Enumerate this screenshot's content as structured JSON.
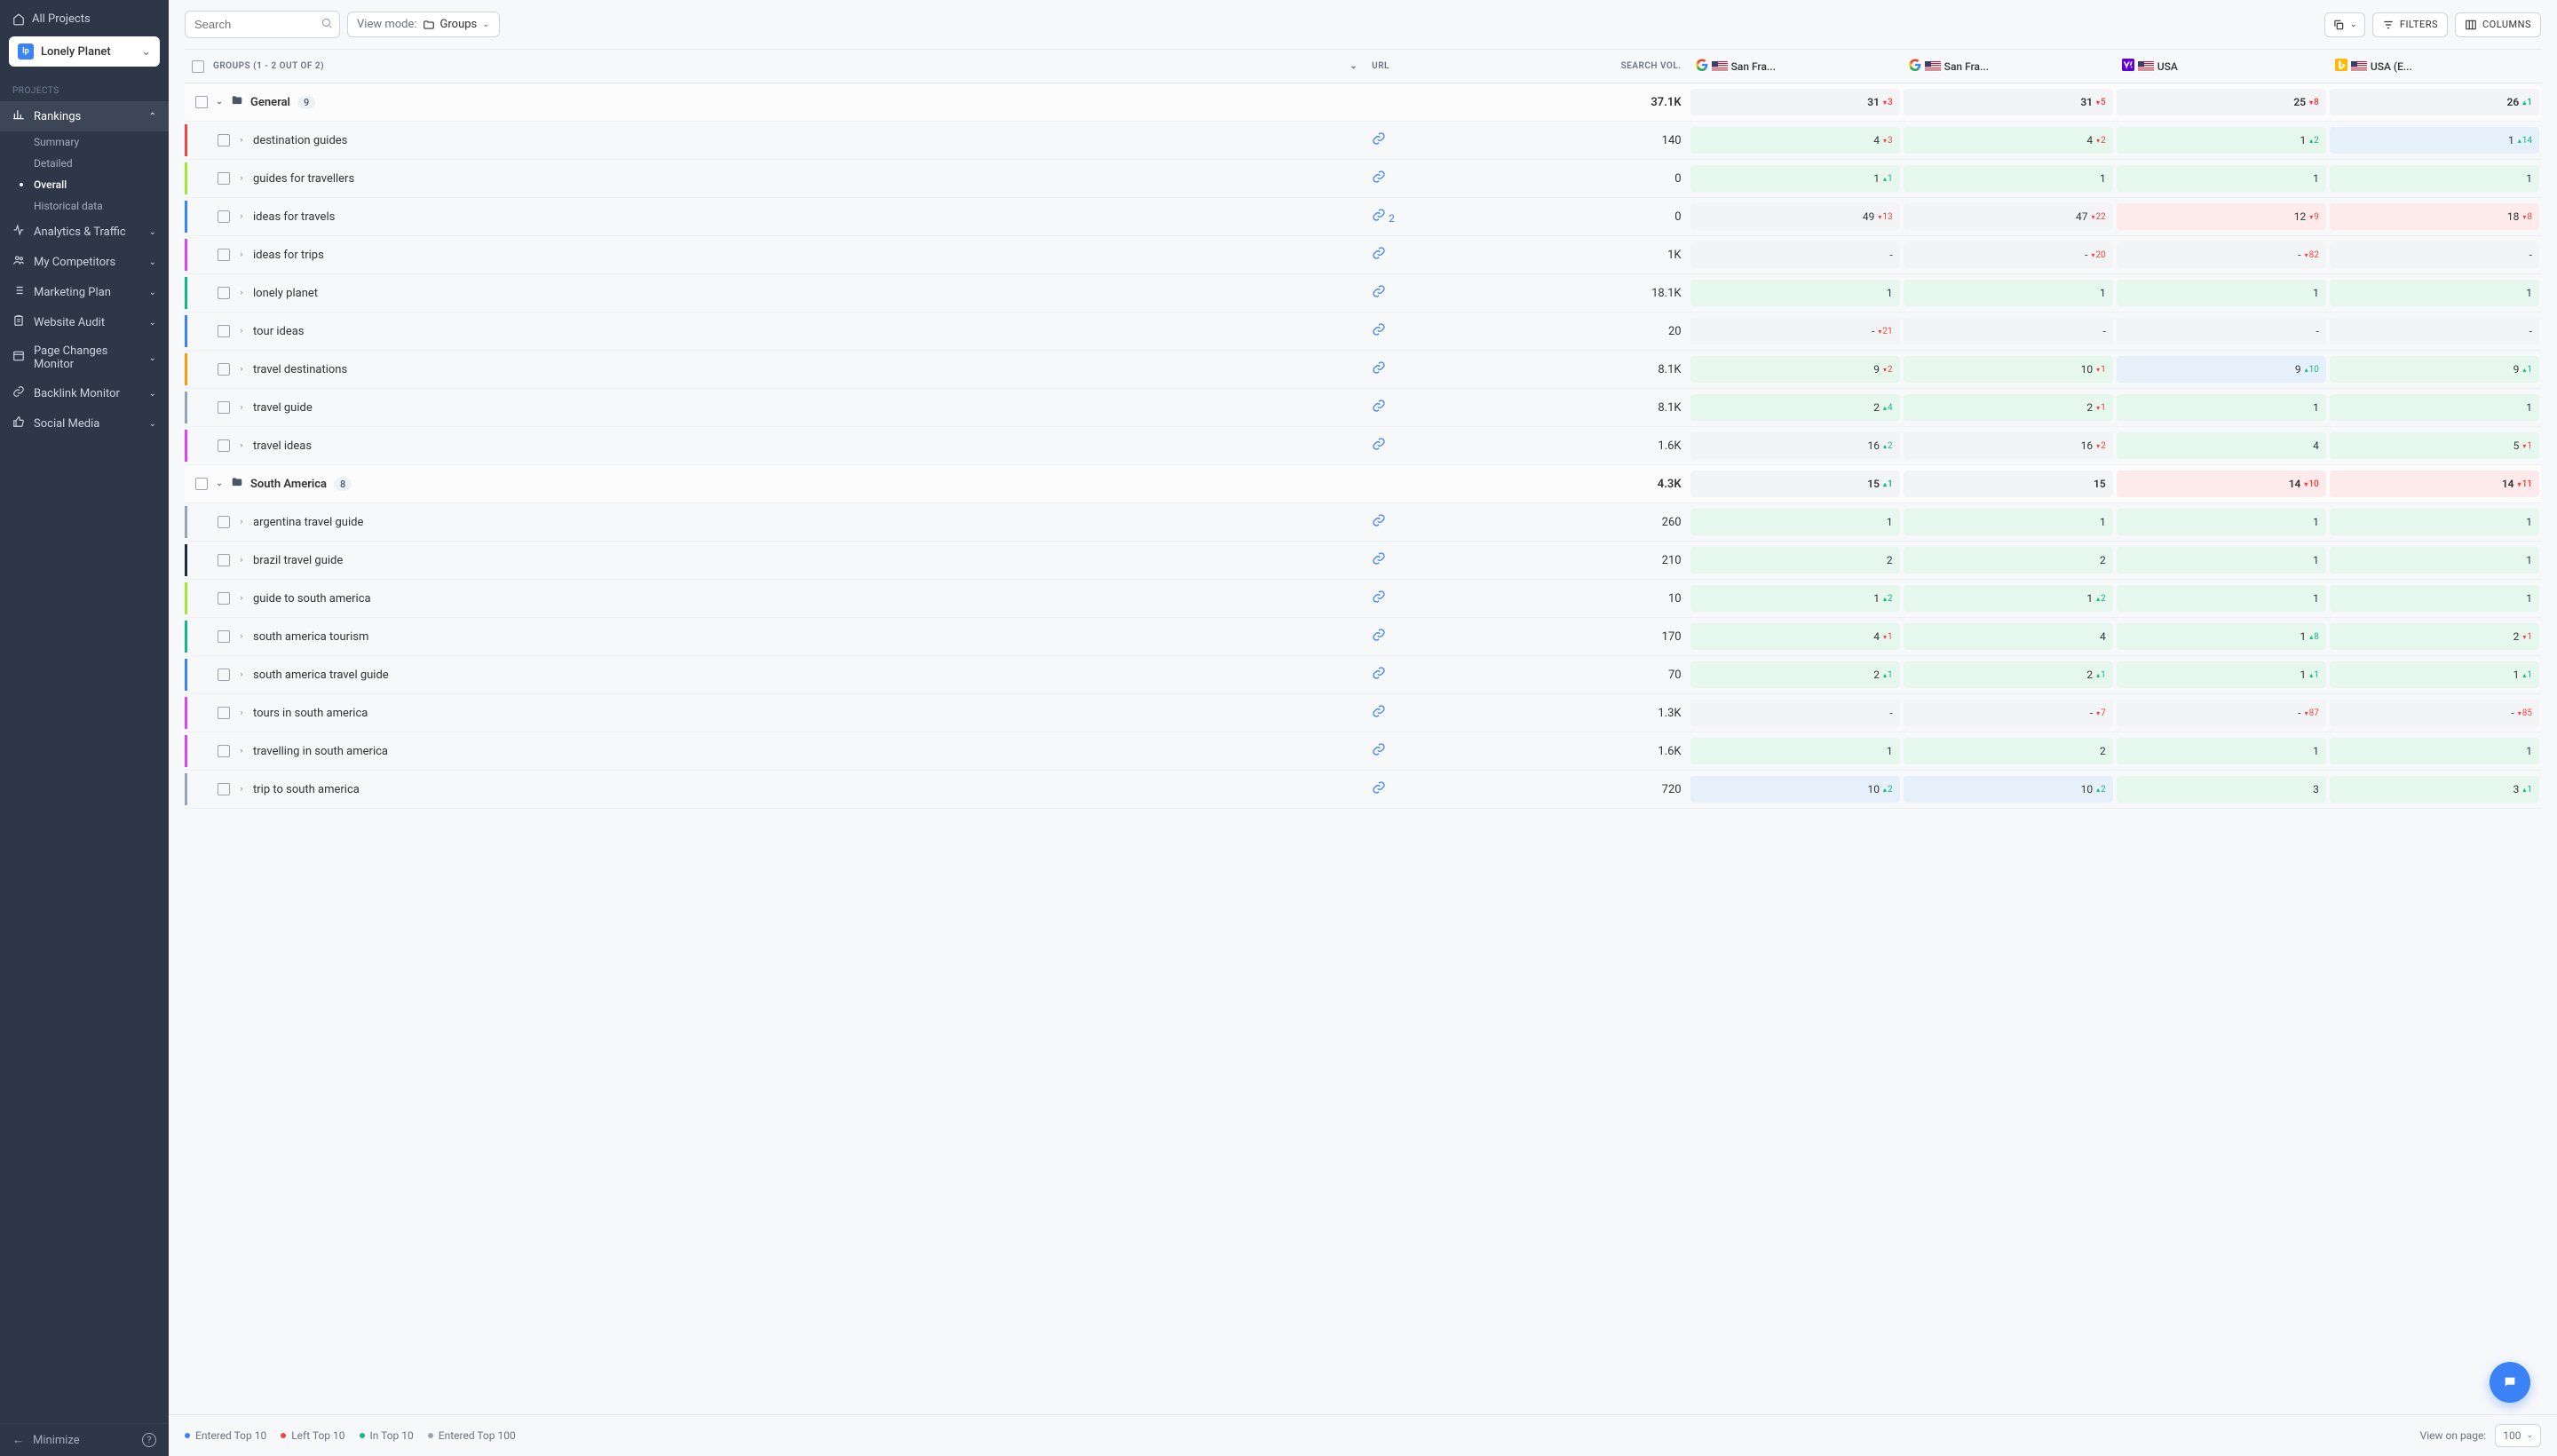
{
  "sidebar": {
    "all_projects": "All Projects",
    "project_name": "Lonely Planet",
    "project_abbr": "lp",
    "heading": "PROJECTS",
    "nav": [
      {
        "label": "Rankings",
        "icon": "chart",
        "expanded": true,
        "subs": [
          {
            "label": "Summary",
            "active": false
          },
          {
            "label": "Detailed",
            "active": false
          },
          {
            "label": "Overall",
            "active": true
          },
          {
            "label": "Historical data",
            "active": false
          }
        ]
      },
      {
        "label": "Analytics & Traffic",
        "icon": "pulse"
      },
      {
        "label": "My Competitors",
        "icon": "users"
      },
      {
        "label": "Marketing Plan",
        "icon": "list"
      },
      {
        "label": "Website Audit",
        "icon": "clipboard"
      },
      {
        "label": "Page Changes Monitor",
        "icon": "window"
      },
      {
        "label": "Backlink Monitor",
        "icon": "link"
      },
      {
        "label": "Social Media",
        "icon": "thumb"
      }
    ],
    "minimize": "Minimize"
  },
  "toolbar": {
    "search_placeholder": "Search",
    "viewmode_label": "View mode:",
    "viewmode_value": "Groups",
    "filters": "FILTERS",
    "columns": "COLUMNS"
  },
  "table": {
    "groups_header": "GROUPS (1 - 2 OUT OF 2)",
    "url_header": "URL",
    "sv_header": "SEARCH VOL.",
    "engines": [
      {
        "type": "google",
        "label": "San Fra..."
      },
      {
        "type": "google",
        "label": "San Fra..."
      },
      {
        "type": "yahoo",
        "label": "USA"
      },
      {
        "type": "bing",
        "label": "USA (E..."
      }
    ],
    "groups": [
      {
        "name": "General",
        "count": "9",
        "sv": "37.1K",
        "ranks": [
          {
            "val": "31",
            "delta": "3",
            "dir": "down",
            "color": "grey"
          },
          {
            "val": "31",
            "delta": "5",
            "dir": "down",
            "color": "grey"
          },
          {
            "val": "25",
            "delta": "8",
            "dir": "down",
            "color": "grey"
          },
          {
            "val": "26",
            "delta": "1",
            "dir": "up",
            "color": "grey"
          }
        ],
        "rows": [
          {
            "bar": "#ef4444",
            "kw": "destination guides",
            "links": "",
            "sv": "140",
            "ranks": [
              {
                "val": "4",
                "delta": "3",
                "dir": "down",
                "color": "green"
              },
              {
                "val": "4",
                "delta": "2",
                "dir": "down",
                "color": "green"
              },
              {
                "val": "1",
                "delta": "2",
                "dir": "up",
                "color": "green"
              },
              {
                "val": "1",
                "delta": "14",
                "dir": "up",
                "color": "blue"
              }
            ]
          },
          {
            "bar": "#a3e635",
            "kw": "guides for travellers",
            "links": "",
            "sv": "0",
            "ranks": [
              {
                "val": "1",
                "delta": "1",
                "dir": "up",
                "color": "green"
              },
              {
                "val": "1",
                "delta": "",
                "dir": "",
                "color": "green"
              },
              {
                "val": "1",
                "delta": "",
                "dir": "",
                "color": "green"
              },
              {
                "val": "1",
                "delta": "",
                "dir": "",
                "color": "green"
              }
            ]
          },
          {
            "bar": "#3b82f6",
            "kw": "ideas for travels",
            "links": "2",
            "sv": "0",
            "ranks": [
              {
                "val": "49",
                "delta": "13",
                "dir": "down",
                "color": "grey"
              },
              {
                "val": "47",
                "delta": "22",
                "dir": "down",
                "color": "grey"
              },
              {
                "val": "12",
                "delta": "9",
                "dir": "down",
                "color": "red"
              },
              {
                "val": "18",
                "delta": "8",
                "dir": "down",
                "color": "red"
              }
            ]
          },
          {
            "bar": "#d946ef",
            "kw": "ideas for trips",
            "links": "",
            "sv": "1K",
            "ranks": [
              {
                "val": "-",
                "delta": "",
                "dir": "",
                "color": "grey"
              },
              {
                "val": "-",
                "delta": "20",
                "dir": "down",
                "color": "grey"
              },
              {
                "val": "-",
                "delta": "82",
                "dir": "down",
                "color": "grey"
              },
              {
                "val": "-",
                "delta": "",
                "dir": "",
                "color": "grey"
              }
            ]
          },
          {
            "bar": "#10b981",
            "kw": "lonely planet",
            "links": "",
            "sv": "18.1K",
            "ranks": [
              {
                "val": "1",
                "delta": "",
                "dir": "",
                "color": "green"
              },
              {
                "val": "1",
                "delta": "",
                "dir": "",
                "color": "green"
              },
              {
                "val": "1",
                "delta": "",
                "dir": "",
                "color": "green"
              },
              {
                "val": "1",
                "delta": "",
                "dir": "",
                "color": "green"
              }
            ]
          },
          {
            "bar": "#3b82f6",
            "kw": "tour ideas",
            "links": "",
            "sv": "20",
            "ranks": [
              {
                "val": "-",
                "delta": "21",
                "dir": "down",
                "color": "grey"
              },
              {
                "val": "-",
                "delta": "",
                "dir": "",
                "color": "grey"
              },
              {
                "val": "-",
                "delta": "",
                "dir": "",
                "color": "grey"
              },
              {
                "val": "-",
                "delta": "",
                "dir": "",
                "color": "grey"
              }
            ]
          },
          {
            "bar": "#f59e0b",
            "kw": "travel destinations",
            "links": "",
            "sv": "8.1K",
            "ranks": [
              {
                "val": "9",
                "delta": "2",
                "dir": "down",
                "color": "green"
              },
              {
                "val": "10",
                "delta": "1",
                "dir": "down",
                "color": "green"
              },
              {
                "val": "9",
                "delta": "10",
                "dir": "up",
                "color": "blue"
              },
              {
                "val": "9",
                "delta": "1",
                "dir": "up",
                "color": "green"
              }
            ]
          },
          {
            "bar": "#94a3b8",
            "kw": "travel guide",
            "links": "",
            "sv": "8.1K",
            "ranks": [
              {
                "val": "2",
                "delta": "4",
                "dir": "up",
                "color": "green"
              },
              {
                "val": "2",
                "delta": "1",
                "dir": "down",
                "color": "green"
              },
              {
                "val": "1",
                "delta": "",
                "dir": "",
                "color": "green"
              },
              {
                "val": "1",
                "delta": "",
                "dir": "",
                "color": "green"
              }
            ]
          },
          {
            "bar": "#d946ef",
            "kw": "travel ideas",
            "links": "",
            "sv": "1.6K",
            "ranks": [
              {
                "val": "16",
                "delta": "2",
                "dir": "up",
                "color": "grey"
              },
              {
                "val": "16",
                "delta": "2",
                "dir": "down",
                "color": "grey"
              },
              {
                "val": "4",
                "delta": "",
                "dir": "",
                "color": "green"
              },
              {
                "val": "5",
                "delta": "1",
                "dir": "down",
                "color": "green"
              }
            ]
          }
        ]
      },
      {
        "name": "South America",
        "count": "8",
        "sv": "4.3K",
        "ranks": [
          {
            "val": "15",
            "delta": "1",
            "dir": "up",
            "color": "grey"
          },
          {
            "val": "15",
            "delta": "",
            "dir": "",
            "color": "grey"
          },
          {
            "val": "14",
            "delta": "10",
            "dir": "down",
            "color": "red"
          },
          {
            "val": "14",
            "delta": "11",
            "dir": "down",
            "color": "red"
          }
        ],
        "rows": [
          {
            "bar": "#94a3b8",
            "kw": "argentina travel guide",
            "links": "",
            "sv": "260",
            "ranks": [
              {
                "val": "1",
                "delta": "",
                "dir": "",
                "color": "green"
              },
              {
                "val": "1",
                "delta": "",
                "dir": "",
                "color": "green"
              },
              {
                "val": "1",
                "delta": "",
                "dir": "",
                "color": "green"
              },
              {
                "val": "1",
                "delta": "",
                "dir": "",
                "color": "green"
              }
            ]
          },
          {
            "bar": "#1e293b",
            "kw": "brazil travel guide",
            "links": "",
            "sv": "210",
            "ranks": [
              {
                "val": "2",
                "delta": "",
                "dir": "",
                "color": "green"
              },
              {
                "val": "2",
                "delta": "",
                "dir": "",
                "color": "green"
              },
              {
                "val": "1",
                "delta": "",
                "dir": "",
                "color": "green"
              },
              {
                "val": "1",
                "delta": "",
                "dir": "",
                "color": "green"
              }
            ]
          },
          {
            "bar": "#a3e635",
            "kw": "guide to south america",
            "links": "",
            "sv": "10",
            "ranks": [
              {
                "val": "1",
                "delta": "2",
                "dir": "up",
                "color": "green"
              },
              {
                "val": "1",
                "delta": "2",
                "dir": "up",
                "color": "green"
              },
              {
                "val": "1",
                "delta": "",
                "dir": "",
                "color": "green"
              },
              {
                "val": "1",
                "delta": "",
                "dir": "",
                "color": "green"
              }
            ]
          },
          {
            "bar": "#10b981",
            "kw": "south america tourism",
            "links": "",
            "sv": "170",
            "ranks": [
              {
                "val": "4",
                "delta": "1",
                "dir": "down",
                "color": "green"
              },
              {
                "val": "4",
                "delta": "",
                "dir": "",
                "color": "green"
              },
              {
                "val": "1",
                "delta": "8",
                "dir": "up",
                "color": "green"
              },
              {
                "val": "2",
                "delta": "1",
                "dir": "down",
                "color": "green"
              }
            ]
          },
          {
            "bar": "#3b82f6",
            "kw": "south america travel guide",
            "links": "",
            "sv": "70",
            "ranks": [
              {
                "val": "2",
                "delta": "1",
                "dir": "up",
                "color": "green"
              },
              {
                "val": "2",
                "delta": "1",
                "dir": "up",
                "color": "green"
              },
              {
                "val": "1",
                "delta": "1",
                "dir": "up",
                "color": "green"
              },
              {
                "val": "1",
                "delta": "1",
                "dir": "up",
                "color": "green"
              }
            ]
          },
          {
            "bar": "#d946ef",
            "kw": "tours in south america",
            "links": "",
            "sv": "1.3K",
            "ranks": [
              {
                "val": "-",
                "delta": "",
                "dir": "",
                "color": "grey"
              },
              {
                "val": "-",
                "delta": "7",
                "dir": "down",
                "color": "grey"
              },
              {
                "val": "-",
                "delta": "87",
                "dir": "down",
                "color": "grey"
              },
              {
                "val": "-",
                "delta": "85",
                "dir": "down",
                "color": "grey"
              }
            ]
          },
          {
            "bar": "#d946ef",
            "kw": "travelling in south america",
            "links": "",
            "sv": "1.6K",
            "ranks": [
              {
                "val": "1",
                "delta": "",
                "dir": "",
                "color": "green"
              },
              {
                "val": "2",
                "delta": "",
                "dir": "",
                "color": "green"
              },
              {
                "val": "1",
                "delta": "",
                "dir": "",
                "color": "green"
              },
              {
                "val": "1",
                "delta": "",
                "dir": "",
                "color": "green"
              }
            ]
          },
          {
            "bar": "#94a3b8",
            "kw": "trip to south america",
            "links": "",
            "sv": "720",
            "ranks": [
              {
                "val": "10",
                "delta": "2",
                "dir": "up",
                "color": "blue"
              },
              {
                "val": "10",
                "delta": "2",
                "dir": "up",
                "color": "blue"
              },
              {
                "val": "3",
                "delta": "",
                "dir": "",
                "color": "green"
              },
              {
                "val": "3",
                "delta": "1",
                "dir": "up",
                "color": "green"
              }
            ]
          }
        ]
      }
    ]
  },
  "footer": {
    "legend": [
      "Entered Top 10",
      "Left Top 10",
      "In Top 10",
      "Entered Top 100"
    ],
    "view_label": "View on page:",
    "page_size": "100"
  }
}
